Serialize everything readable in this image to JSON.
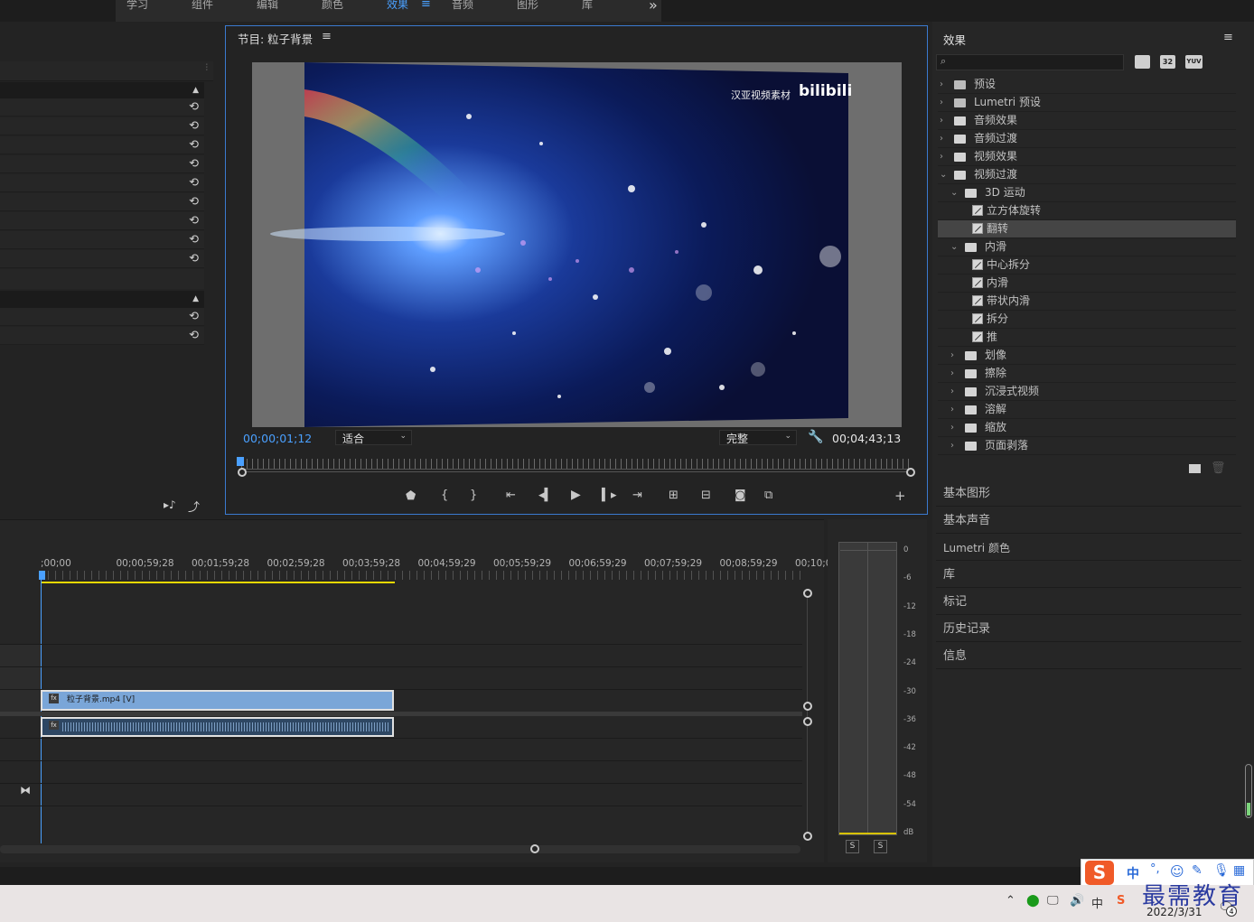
{
  "workspace_tabs": [
    "学习",
    "组件",
    "编辑",
    "颜色",
    "效果",
    "音频",
    "图形",
    "库"
  ],
  "overflow_glyph": "»",
  "program": {
    "title": "节目: 粒子背景",
    "menu_icon": "hamburger-icon",
    "current_tc": "00;00;01;12",
    "fit_option": "适合",
    "quality_option": "完整",
    "duration_tc": "00;04;43;13",
    "watermark": "汉亚视频素材",
    "watermark_logo": "bilibili"
  },
  "effects": {
    "title": "效果",
    "badges": [
      "32",
      "YUV"
    ],
    "tree": [
      {
        "label": "预设",
        "level": 0,
        "type": "star-folder",
        "open": false
      },
      {
        "label": "Lumetri 预设",
        "level": 0,
        "type": "star-folder",
        "open": false
      },
      {
        "label": "音频效果",
        "level": 0,
        "type": "folder",
        "open": false
      },
      {
        "label": "音频过渡",
        "level": 0,
        "type": "folder",
        "open": false
      },
      {
        "label": "视频效果",
        "level": 0,
        "type": "folder",
        "open": false
      },
      {
        "label": "视频过渡",
        "level": 0,
        "type": "folder",
        "open": true
      },
      {
        "label": "3D 运动",
        "level": 1,
        "type": "folder",
        "open": true
      },
      {
        "label": "立方体旋转",
        "level": 2,
        "type": "fx"
      },
      {
        "label": "翻转",
        "level": 2,
        "type": "fx",
        "selected": true
      },
      {
        "label": "内滑",
        "level": 1,
        "type": "folder",
        "open": true
      },
      {
        "label": "中心拆分",
        "level": 2,
        "type": "fx"
      },
      {
        "label": "内滑",
        "level": 2,
        "type": "fx"
      },
      {
        "label": "带状内滑",
        "level": 2,
        "type": "fx"
      },
      {
        "label": "拆分",
        "level": 2,
        "type": "fx"
      },
      {
        "label": "推",
        "level": 2,
        "type": "fx"
      },
      {
        "label": "划像",
        "level": 1,
        "type": "folder",
        "open": false
      },
      {
        "label": "擦除",
        "level": 1,
        "type": "folder",
        "open": false
      },
      {
        "label": "沉浸式视频",
        "level": 1,
        "type": "folder",
        "open": false
      },
      {
        "label": "溶解",
        "level": 1,
        "type": "folder",
        "open": false
      },
      {
        "label": "缩放",
        "level": 1,
        "type": "folder",
        "open": false
      },
      {
        "label": "页面剥落",
        "level": 1,
        "type": "folder",
        "open": false
      }
    ],
    "sections": [
      "基本图形",
      "基本声音",
      "Lumetri 颜色",
      "库",
      "标记",
      "历史记录",
      "信息"
    ]
  },
  "timeline": {
    "ruler": [
      ";00;00",
      "00;00;59;28",
      "00;01;59;28",
      "00;02;59;28",
      "00;03;59;28",
      "00;04;59;29",
      "00;05;59;29",
      "00;06;59;29",
      "00;07;59;29",
      "00;08;59;29",
      "00;10;0"
    ],
    "video_clip": "粒子背景.mp4 [V]",
    "fx_badge": "fx"
  },
  "meter": {
    "scale": [
      "0",
      "-6",
      "-12",
      "-18",
      "-24",
      "-30",
      "-36",
      "-42",
      "-48",
      "-54",
      "dB"
    ],
    "solo": [
      "S",
      "S"
    ]
  },
  "ime": {
    "mode": "中",
    "punct": "°,"
  },
  "brand_watermark": "最需教育",
  "taskbar": {
    "date": "2022/3/31",
    "ime": "中",
    "badge": "4"
  },
  "colors": {
    "accent": "#4aa0ff",
    "panel_border": "#3b7ad0",
    "clip_video": "#7aa6d8",
    "work_area": "#e8d800"
  }
}
